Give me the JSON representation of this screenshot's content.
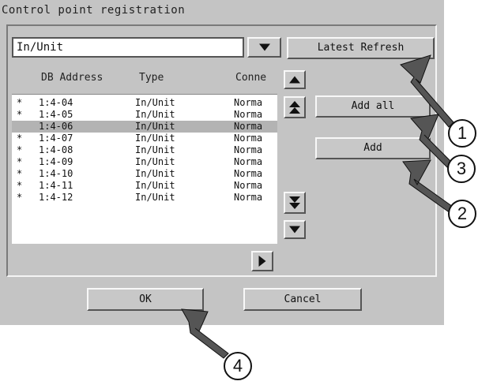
{
  "dialog": {
    "title": "Control point registration"
  },
  "filter": {
    "selected": "In/Unit",
    "dropdown_icon": "triangle-down"
  },
  "buttons": {
    "latest_refresh": "Latest Refresh",
    "add_all": "Add all",
    "add": "Add",
    "ok": "OK",
    "cancel": "Cancel"
  },
  "table": {
    "columns": [
      "DB Address",
      "Type",
      "Conne"
    ],
    "rows": [
      {
        "mark": "*",
        "address": "1:4-04",
        "type": "In/Unit",
        "conn": "Norma",
        "selected": false
      },
      {
        "mark": "*",
        "address": "1:4-05",
        "type": "In/Unit",
        "conn": "Norma",
        "selected": false
      },
      {
        "mark": "",
        "address": "1:4-06",
        "type": "In/Unit",
        "conn": "Norma",
        "selected": true
      },
      {
        "mark": "*",
        "address": "1:4-07",
        "type": "In/Unit",
        "conn": "Norma",
        "selected": false
      },
      {
        "mark": "*",
        "address": "1:4-08",
        "type": "In/Unit",
        "conn": "Norma",
        "selected": false
      },
      {
        "mark": "*",
        "address": "1:4-09",
        "type": "In/Unit",
        "conn": "Norma",
        "selected": false
      },
      {
        "mark": "*",
        "address": "1:4-10",
        "type": "In/Unit",
        "conn": "Norma",
        "selected": false
      },
      {
        "mark": "*",
        "address": "1:4-11",
        "type": "In/Unit",
        "conn": "Norma",
        "selected": false
      },
      {
        "mark": "*",
        "address": "1:4-12",
        "type": "In/Unit",
        "conn": "Norma",
        "selected": false
      }
    ]
  },
  "scroll_icons": {
    "up": "triangle-up",
    "page_up": "double-triangle-up",
    "page_down": "double-triangle-down",
    "down": "triangle-down",
    "right": "triangle-right"
  },
  "callouts": [
    "1",
    "3",
    "2",
    "4"
  ],
  "colors": {
    "dialog_bg": "#c4c4c4",
    "arrow": "#555555",
    "selection": "#b3b3b3"
  }
}
